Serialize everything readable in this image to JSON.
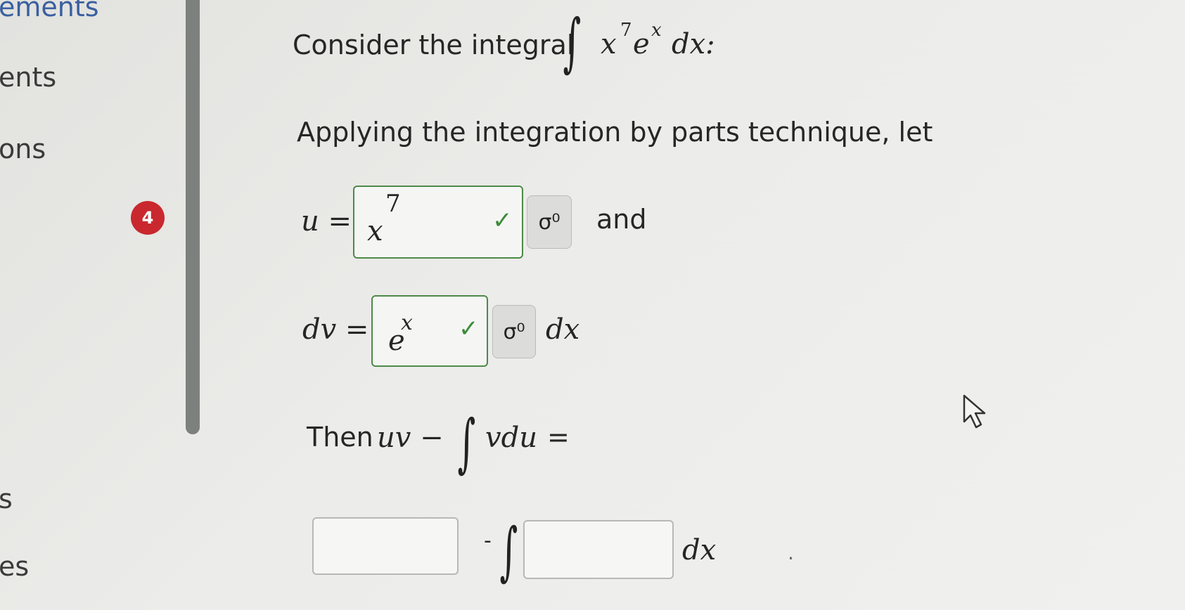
{
  "sidebar": {
    "items": [
      "ements",
      "ents",
      "ons",
      "s",
      "es"
    ]
  },
  "question": {
    "number": "4",
    "intro": "Consider the integral",
    "integral_symbol": "∫",
    "integrand_x": "x",
    "integrand_exp": "7",
    "integrand_e": "e",
    "integrand_e_exp": "x",
    "integrand_dx": "dx:",
    "applying": "Applying the integration by parts technique, let",
    "u_label": "u =",
    "u_value": "x",
    "u_exp": "7",
    "and": "and",
    "dv_label": "dv =",
    "dv_value": "e",
    "dv_exp": "x",
    "dv_dx": "dx",
    "then": "Then",
    "uv": "uv −",
    "vdu": "vdu",
    "equals": "=",
    "minus": "-",
    "final_dx": "dx",
    "period": "."
  },
  "icons": {
    "check": "✓",
    "key": "σ⁰"
  }
}
